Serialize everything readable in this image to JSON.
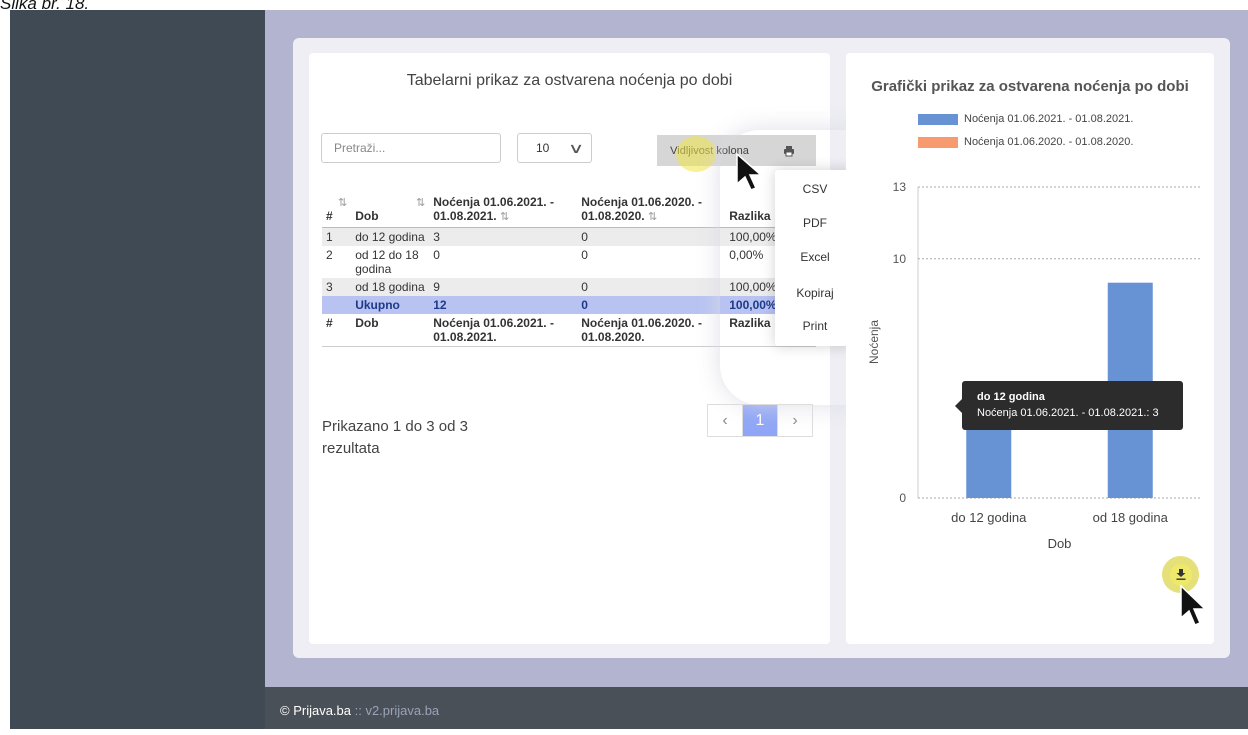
{
  "caption": "Slika br. 18.",
  "left_card": {
    "title": "Tabelarni prikaz za ostvarena noćenja po dobi",
    "search": {
      "placeholder": "Pretraži...",
      "value": ""
    },
    "page_size": {
      "selected": "10"
    },
    "column_visibility_label": "Vidljivost kolona",
    "export_icon": "print-icon",
    "table": {
      "headers": [
        "#",
        "Dob",
        "Noćenja 01.06.2021. - 01.08.2021.",
        "Noćenja 01.06.2020. - 01.08.2020.",
        "Razlika"
      ],
      "rows": [
        [
          "1",
          "do 12 godina",
          "3",
          "0",
          "100,00%"
        ],
        [
          "2",
          "od 12 do 18 godina",
          "0",
          "0",
          "0,00%"
        ],
        [
          "3",
          "od 18 godina",
          "9",
          "0",
          "100,00%"
        ]
      ],
      "total": [
        "",
        "Ukupno",
        "12",
        "0",
        "100,00%"
      ],
      "footer": [
        "#",
        "Dob",
        "Noćenja 01.06.2021. - 01.08.2021.",
        "Noćenja 01.06.2020. - 01.08.2020.",
        "Razlika"
      ]
    },
    "info": "Prikazano 1 do 3 od 3 rezultata",
    "pagination": {
      "prev": "‹",
      "current": "1",
      "next": "›"
    },
    "export_menu": [
      "CSV",
      "PDF",
      "Excel",
      "Kopiraj",
      "Print"
    ]
  },
  "right_card": {
    "title": "Grafički prikaz za ostvarena noćenja po dobi",
    "tooltip": {
      "title": "do 12 godina",
      "line": "Noćenja 01.06.2021. - 01.08.2021.: 3"
    },
    "download_icon": "download-icon"
  },
  "chart_data": {
    "type": "bar",
    "title": "Grafički prikaz za ostvarena noćenja po dobi",
    "categories": [
      "do 12 godina",
      "od 18 godina"
    ],
    "series": [
      {
        "name": "Noćenja 01.06.2021. - 01.08.2021.",
        "values": [
          3,
          9
        ],
        "color": "#6792d4"
      },
      {
        "name": "Noćenja 01.06.2020. - 01.08.2020.",
        "values": [
          0,
          0
        ],
        "color": "#f79a6f"
      }
    ],
    "xlabel": "Dob",
    "ylabel": "Noćenja",
    "yticks": [
      "0",
      "10",
      "13"
    ],
    "ylim": [
      0,
      13
    ],
    "legend_position": "top",
    "grid": true
  },
  "footer": {
    "brand": "© Prijava.ba",
    "sep": " :: ",
    "domain": "v2.prijava.ba"
  }
}
